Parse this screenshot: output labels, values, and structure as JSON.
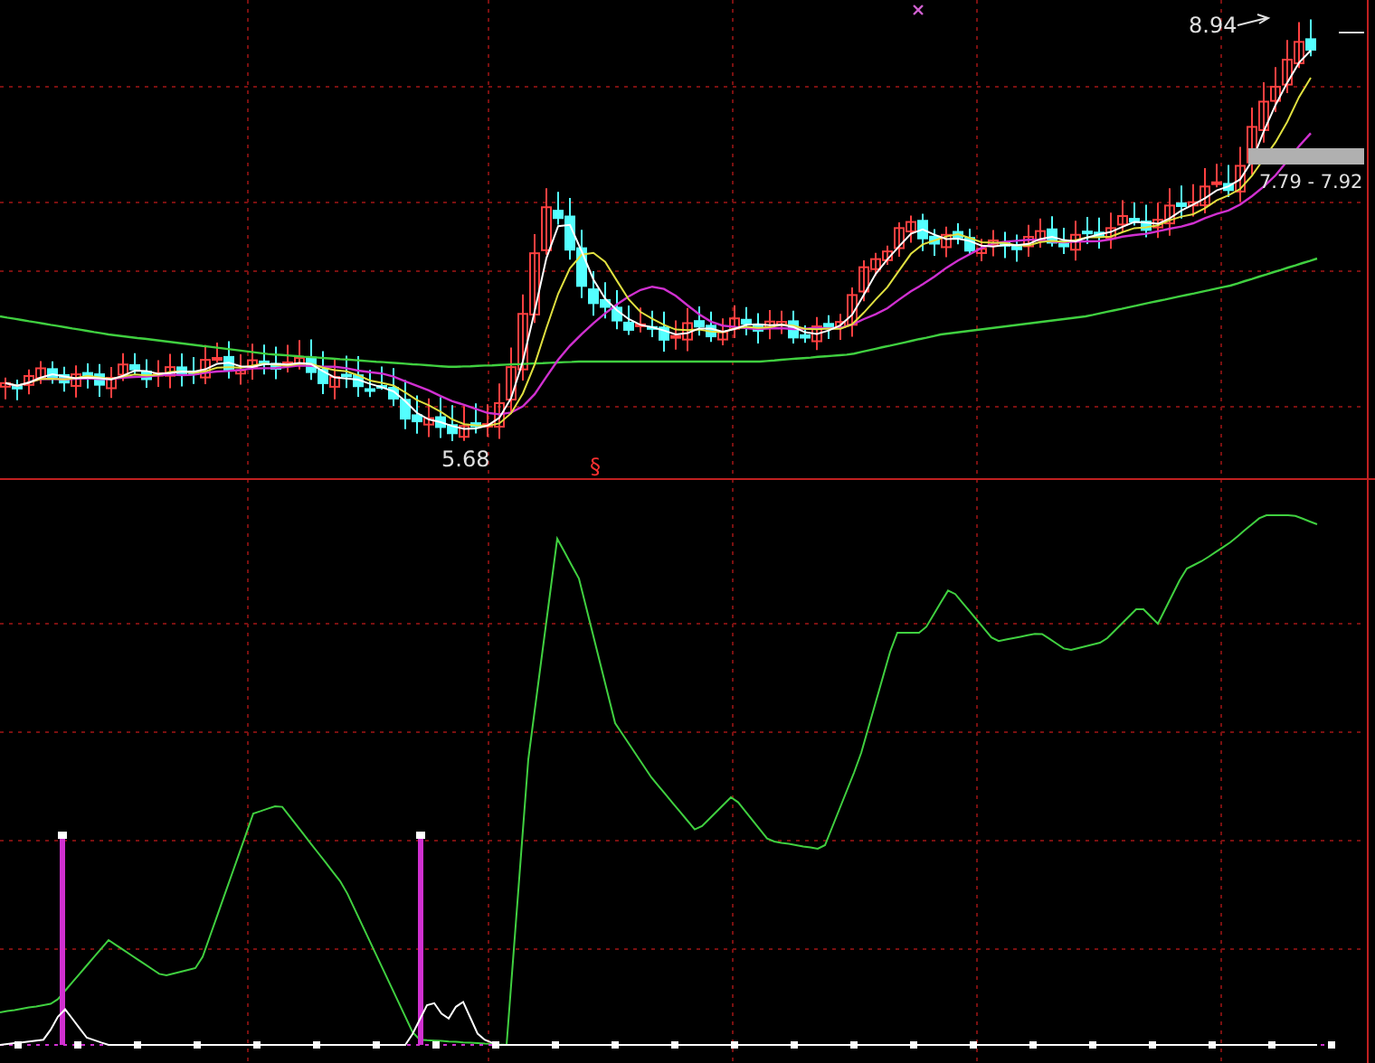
{
  "price_labels": [
    {
      "kind": "high",
      "text": "8.94"
    },
    {
      "kind": "range",
      "text": "7.79 - 7.92"
    },
    {
      "kind": "low",
      "text": "5.68"
    }
  ],
  "divider_mark": "§"
}
